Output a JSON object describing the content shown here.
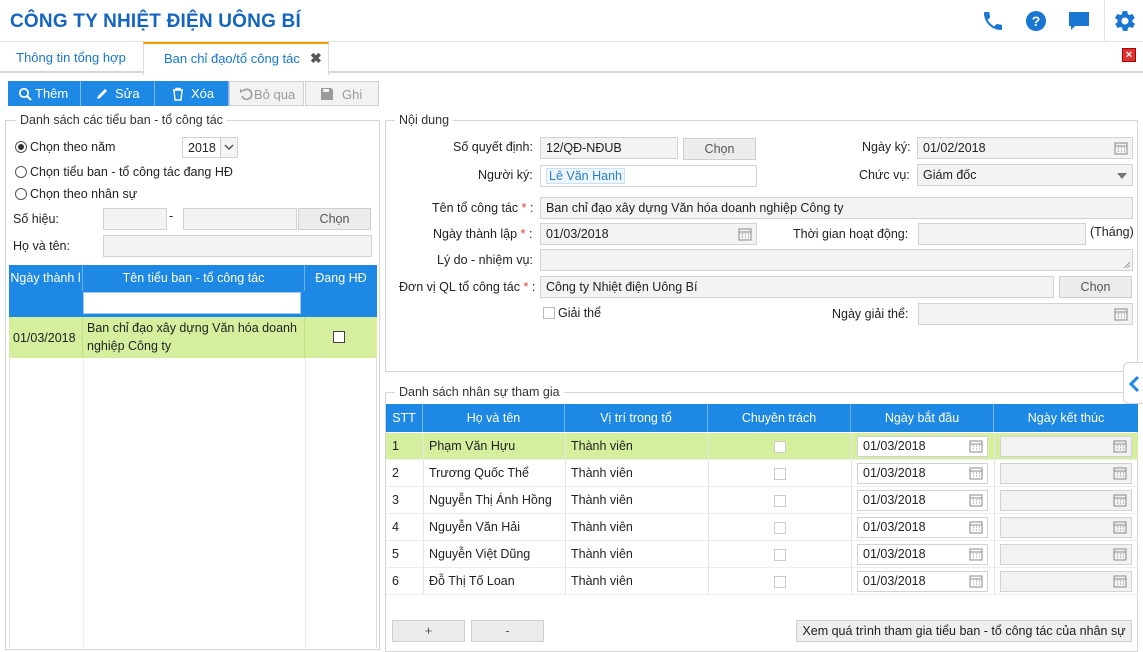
{
  "header": {
    "title": "CÔNG TY NHIỆT ĐIỆN UÔNG BÍ",
    "icons": [
      "phone-icon",
      "help-icon",
      "chat-icon",
      "gear-icon"
    ]
  },
  "tabs": [
    {
      "label": "Thông tin tổng hợp"
    },
    {
      "label": "Ban chỉ đạo/tổ công tác",
      "close": "✖"
    }
  ],
  "toolbar": {
    "add": "Thêm",
    "edit": "Sửa",
    "delete": "Xóa",
    "skip": "Bỏ qua",
    "save": "Ghi"
  },
  "left": {
    "legend": "Danh sách các tiểu ban - tổ công tác",
    "radio_year": "Chọn theo năm",
    "year_value": "2018",
    "radio_active": "Chọn tiểu ban - tổ công tác đang HĐ",
    "radio_staff": "Chọn theo nhân sự",
    "so_hieu_label": "Số hiệu:",
    "dash": "-",
    "chon": "Chọn",
    "ho_ten_label": "Họ và tên:",
    "columns": [
      "Ngày thành l",
      "Tên tiểu ban - tổ công tác",
      "Đang HĐ"
    ],
    "rows": [
      {
        "date": "01/03/2018",
        "name_line1": "Ban chỉ đạo xây dựng Văn hóa doanh",
        "name_line2": "nghiệp Công ty",
        "active": false
      }
    ]
  },
  "content": {
    "legend": "Nội dung",
    "so_qd_label": "Số quyết định:",
    "so_qd_value": "12/QĐ-NĐUB",
    "chon": "Chọn",
    "ngay_ky_label": "Ngày ký:",
    "ngay_ky_value": "01/02/2018",
    "nguoi_ky_label": "Người ký:",
    "nguoi_ky_value": "Lê Văn Hanh",
    "chuc_vu_label": "Chức vụ:",
    "chuc_vu_value": "Giám đốc",
    "ten_to_label": "Tên tổ công tác",
    "ten_to_value": "Ban chỉ đạo xây dựng Văn hóa doanh nghiệp Công ty",
    "ngay_tl_label": "Ngày thành lập",
    "ngay_tl_value": "01/03/2018",
    "tg_hd_label": "Thời gian hoạt động:",
    "thang": "(Tháng)",
    "ly_do_label": "Lý do - nhiệm vụ:",
    "don_vi_label": "Đơn vị QL tổ công tác",
    "don_vi_value": "Công ty Nhiệt điện Uông Bí",
    "giai_the": "Giải thể",
    "ngay_gt_label": "Ngày giải thể:",
    "req": "*",
    "colon": ":"
  },
  "staff": {
    "legend": "Danh sách nhân sự tham gia",
    "columns": [
      "STT",
      "Họ và tên",
      "Vị trí trong tổ",
      "Chuyên trách",
      "Ngày bắt đầu",
      "Ngày kết thúc"
    ],
    "rows": [
      {
        "stt": "1",
        "name": "Phạm Văn Hựu",
        "role": "Thành viên",
        "start": "01/03/2018"
      },
      {
        "stt": "2",
        "name": "Trương Quốc Thể",
        "role": "Thành viên",
        "start": "01/03/2018"
      },
      {
        "stt": "3",
        "name": "Nguyễn Thị Ánh Hồng",
        "role": "Thành viên",
        "start": "01/03/2018"
      },
      {
        "stt": "4",
        "name": "Nguyễn Văn Hải",
        "role": "Thành viên",
        "start": "01/03/2018"
      },
      {
        "stt": "5",
        "name": "Nguyễn Việt Dũng",
        "role": "Thành viên",
        "start": "01/03/2018"
      },
      {
        "stt": "6",
        "name": "Đỗ Thị Tố Loan",
        "role": "Thành viên",
        "start": "01/03/2018"
      }
    ],
    "plus": "+",
    "minus": "-",
    "history_button": "Xem quá trình tham gia tiểu ban - tổ công tác của nhân sự"
  },
  "colors": {
    "accent": "#1e88e5",
    "title": "#1565c0",
    "selected_row": "#d6ef9e",
    "tab_active": "#f0a000"
  }
}
